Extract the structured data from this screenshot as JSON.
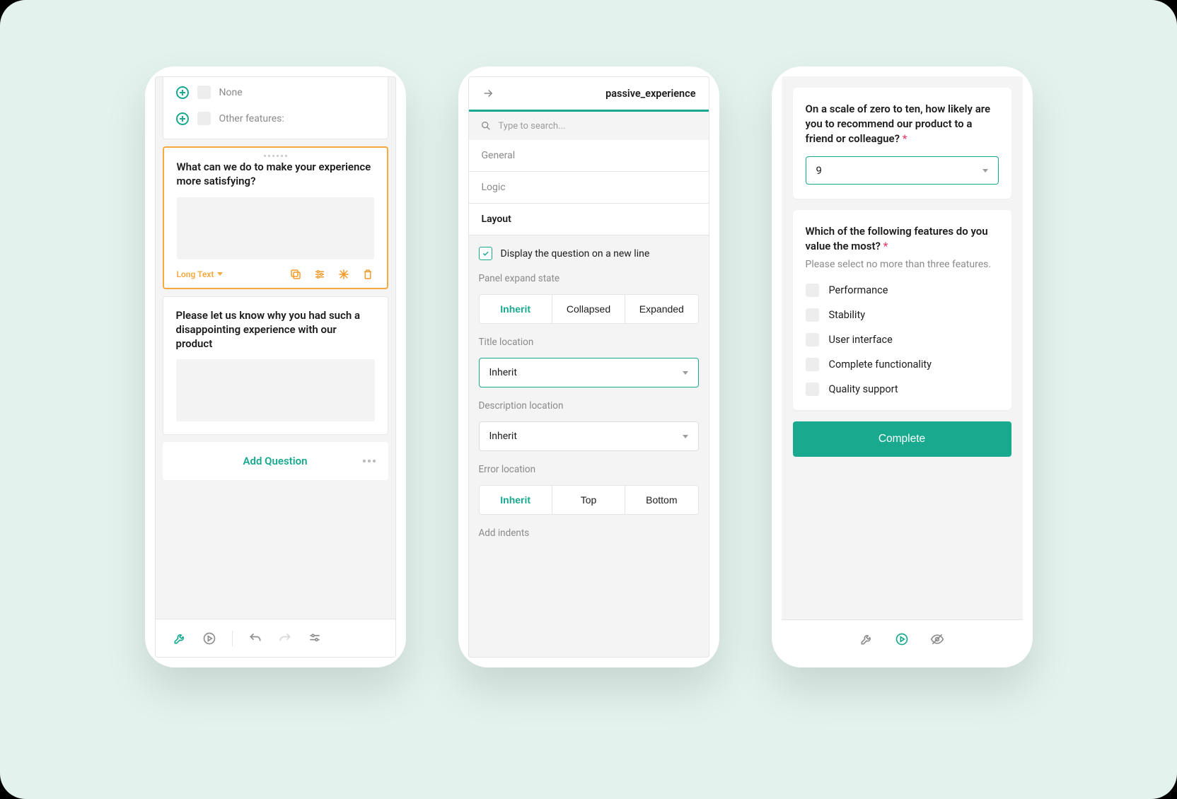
{
  "screen1": {
    "top_options": [
      "None",
      "Other features:"
    ],
    "q_selected": {
      "title": "What can we do to make your experience more satisfying?",
      "type_label": "Long Text"
    },
    "q_plain": {
      "title": "Please let us know why you had such a disappointing experience with our product"
    },
    "add_question": "Add Question"
  },
  "screen2": {
    "title": "passive_experience",
    "search_placeholder": "Type to search...",
    "tabs": [
      "General",
      "Logic",
      "Layout"
    ],
    "active_tab": "Layout",
    "display_newline_label": "Display the question on a new line",
    "panel_expand_label": "Panel expand state",
    "panel_expand_options": [
      "Inherit",
      "Collapsed",
      "Expanded"
    ],
    "title_location_label": "Title location",
    "title_location_value": "Inherit",
    "desc_location_label": "Description location",
    "desc_location_value": "Inherit",
    "error_location_label": "Error location",
    "error_location_options": [
      "Inherit",
      "Top",
      "Bottom"
    ],
    "add_indents_label": "Add indents"
  },
  "screen3": {
    "q1_title": "On a scale of zero to ten, how likely are you to recommend our product to a friend or colleague?",
    "q1_value": "9",
    "q2_title": "Which of the following features do you value the most?",
    "q2_desc": "Please select no more than three features.",
    "q2_options": [
      "Performance",
      "Stability",
      "User interface",
      "Complete functionality",
      "Quality support"
    ],
    "complete_label": "Complete"
  }
}
